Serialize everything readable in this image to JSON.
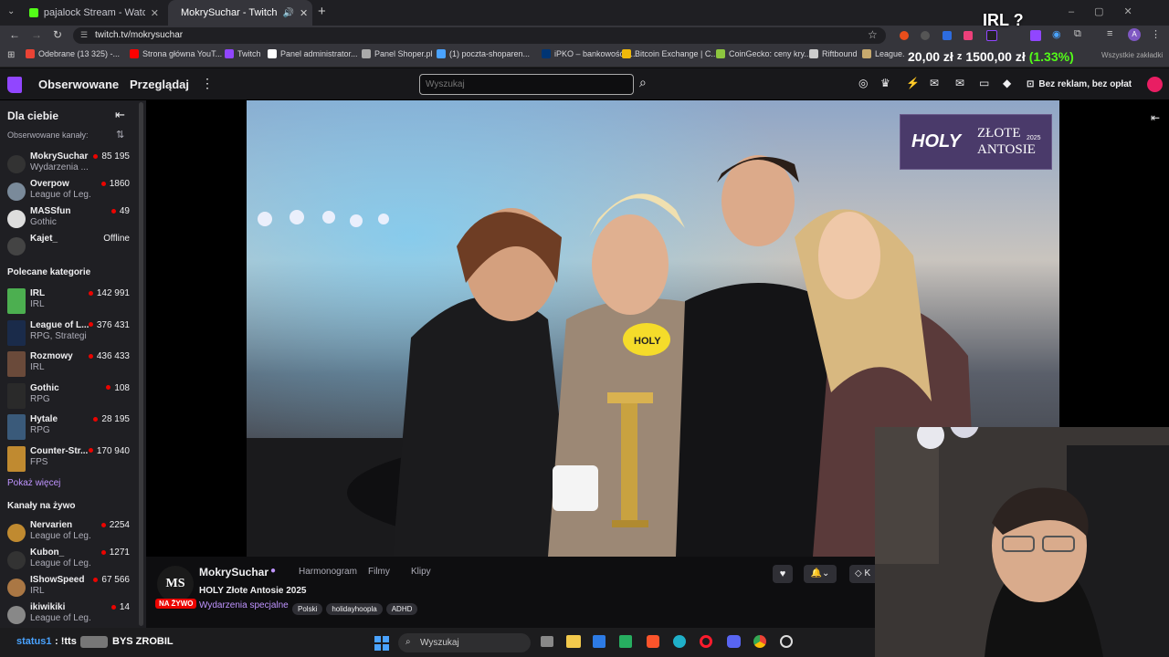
{
  "browser": {
    "tabs": [
      {
        "title": "pajalock Stream - Watch Live o",
        "icon_color": "#53fc18"
      },
      {
        "title": "MokrySuchar - Twitch",
        "icon_color": "#9146ff"
      }
    ],
    "url": "twitch.tv/mokrysuchar",
    "bookmarks": [
      {
        "label": "Odebrane (13 325) -...",
        "color": "#ea4335"
      },
      {
        "label": "Strona główna YouT...",
        "color": "#ff0000"
      },
      {
        "label": "Twitch",
        "color": "#9146ff"
      },
      {
        "label": "Panel administrator...",
        "color": "#ffffff"
      },
      {
        "label": "Panel Shoper.pl",
        "color": "#aaaaaa"
      },
      {
        "label": "(1) poczta-shoparen...",
        "color": "#4aa3ff"
      },
      {
        "label": "iPKO – bankowość e...",
        "color": "#003574"
      },
      {
        "label": "Bitcoin Exchange | C...",
        "color": "#f0b90b"
      },
      {
        "label": "CoinGecko: ceny kry...",
        "color": "#8dc63f"
      },
      {
        "label": "Riftbound",
        "color": "#cccccc"
      },
      {
        "label": "League...",
        "color": "#c8aa6e"
      }
    ],
    "all_bookmarks": "Wszystkie zakładki"
  },
  "overlay": {
    "irl_question": "IRL ?",
    "donation_goal": "20,00 zł",
    "donation_of": "z",
    "donation_target": "1500,00 zł",
    "donation_pct": "(1.33%)"
  },
  "twitch": {
    "nav": {
      "following": "Obserwowane",
      "browse": "Przeglądaj",
      "search_placeholder": "Wyszukaj",
      "no_ads": "Bez reklam, bez opłat"
    },
    "sidebar": {
      "for_you": "Dla ciebie",
      "followed_label": "Obserwowane kanały:",
      "followed": [
        {
          "name": "MokrySuchar",
          "game": "Wydarzenia ...",
          "viewers": "85 195",
          "color": "#333"
        },
        {
          "name": "Overpow",
          "game": "League of Leg...",
          "viewers": "1860",
          "color": "#7a8a9a"
        },
        {
          "name": "MASSfun",
          "game": "Gothic",
          "viewers": "49",
          "color": "#dddddd"
        },
        {
          "name": "Kajet_",
          "game": "",
          "viewers": "Offline",
          "color": "#444"
        }
      ],
      "categories_label": "Polecane kategorie",
      "categories": [
        {
          "name": "IRL",
          "tag": "IRL",
          "viewers": "142 991",
          "color": "#4caf50"
        },
        {
          "name": "League of L...",
          "tag": "RPG, Strategi",
          "viewers": "376 431",
          "color": "#1a2b4a"
        },
        {
          "name": "Rozmowy",
          "tag": "IRL",
          "viewers": "436 433",
          "color": "#6a4a3a"
        },
        {
          "name": "Gothic",
          "tag": "RPG",
          "viewers": "108",
          "color": "#2a2a2a"
        },
        {
          "name": "Hytale",
          "tag": "RPG",
          "viewers": "28 195",
          "color": "#3a5a7a"
        },
        {
          "name": "Counter-Str...",
          "tag": "FPS",
          "viewers": "170 940",
          "color": "#c08a30"
        }
      ],
      "show_more": "Pokaż więcej",
      "live_label": "Kanały na żywo",
      "live": [
        {
          "name": "Nervarien",
          "game": "League of Leg...",
          "viewers": "2254",
          "color": "#c08a30"
        },
        {
          "name": "Kubon_",
          "game": "League of Leg...",
          "viewers": "1271",
          "color": "#333"
        },
        {
          "name": "IShowSpeed",
          "game": "IRL",
          "viewers": "67 566",
          "color": "#aa7744"
        },
        {
          "name": "ikiwikiki",
          "game": "League of Leg...",
          "viewers": "14",
          "color": "#888"
        }
      ]
    },
    "stream": {
      "channel": "MokrySuchar",
      "tabs": [
        "Harmonogram",
        "Filmy",
        "Klipy"
      ],
      "title": "HOLY Złote Antosie 2025",
      "live_badge": "NA ŻYWO",
      "category": "Wydarzenia specjalne",
      "tags": [
        "Polski",
        "holidayhoopla",
        "ADHD"
      ],
      "logo_brand": "HOLY",
      "logo_line1": "ZŁOTE",
      "logo_line2": "ANTOSIE",
      "logo_year": "2025",
      "mic_label": "HOLY",
      "follow_k": "K"
    }
  },
  "taskbar": {
    "status_user": "status1",
    "status_cmd": ": !tts",
    "status_msg": "BYS ZROBIL",
    "search": "Wyszukaj"
  }
}
